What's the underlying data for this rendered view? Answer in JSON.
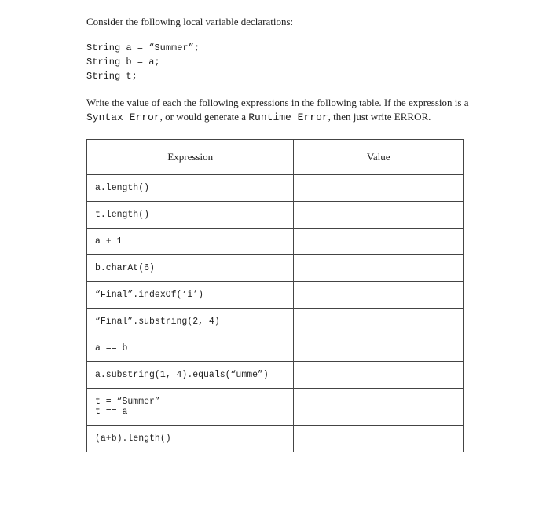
{
  "intro": "Consider the following local variable declarations:",
  "code": "String a = “Summer”;\nString b = a;\nString t;",
  "instructions_pre": "Write the value of each the following expressions in the following table. If the expression is a ",
  "syntax_error": "Syntax Error",
  "instructions_mid": ", or would generate a ",
  "runtime_error": "Runtime Error",
  "instructions_post": ", then just write ERROR.",
  "headers": {
    "expression": "Expression",
    "value": "Value"
  },
  "rows": [
    {
      "expr": "a.length()",
      "val": ""
    },
    {
      "expr": "t.length()",
      "val": ""
    },
    {
      "expr": "a + 1",
      "val": ""
    },
    {
      "expr": "b.charAt(6)",
      "val": ""
    },
    {
      "expr": "“Final”.indexOf(‘i’)",
      "val": ""
    },
    {
      "expr": "“Final”.substring(2, 4)",
      "val": ""
    },
    {
      "expr": "a == b",
      "val": ""
    },
    {
      "expr": "a.substring(1, 4).equals(“umme”)",
      "val": ""
    },
    {
      "expr": "t = “Summer”\nt == a",
      "val": ""
    },
    {
      "expr": "(a+b).length()",
      "val": ""
    }
  ]
}
